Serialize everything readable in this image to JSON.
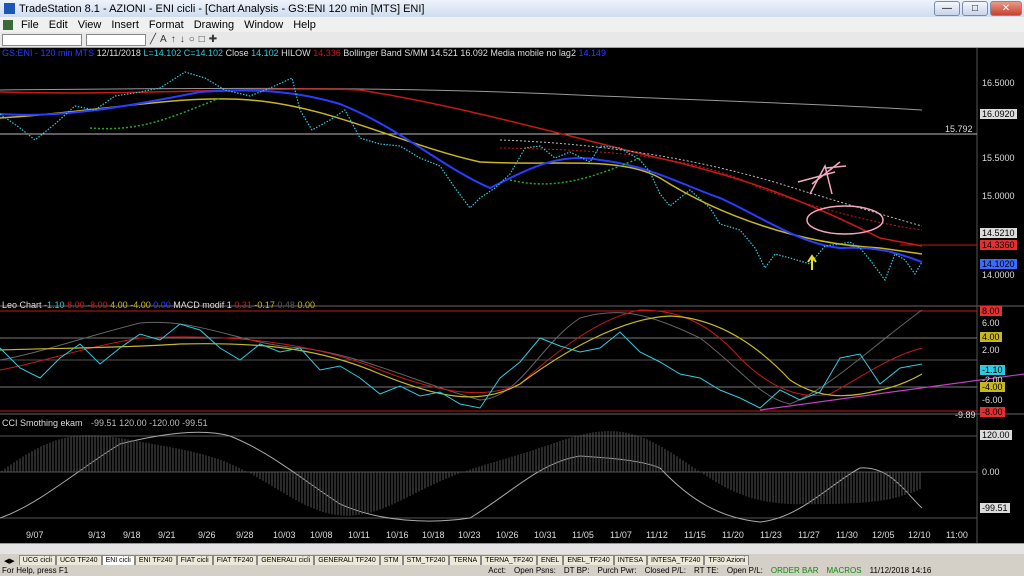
{
  "window": {
    "title": "TradeStation 8.1 - AZIONI - ENI cicli - [Chart Analysis - GS:ENI  120 min  [MTS] ENI]"
  },
  "menu": [
    "File",
    "Edit",
    "View",
    "Insert",
    "Format",
    "Drawing",
    "Window",
    "Help"
  ],
  "header": {
    "symbol": "GS:ENI - 120 min",
    "mts": "MTS",
    "date": "12/11/2018",
    "low": "L=14.102",
    "close": "C=14.102",
    "close_label": "Close",
    "close_val": "14.102",
    "hilow": "HILOW",
    "hilow_val": "14.336",
    "bb_label": "Bollinger Band S/MM",
    "bb_vals": "14.521  16.092",
    "ma_label": "Media mobile no lag2",
    "ma_val": "14.149"
  },
  "price_scale": [
    "16.5000",
    "16.0920",
    "15.792",
    "15.5000",
    "15.0000",
    "14.5210",
    "14.3360",
    "14.1020",
    "14.0000"
  ],
  "osc": {
    "title": "Leo Chart",
    "vals": [
      "-1.10",
      "8.00",
      "-8.00",
      "4.00",
      "-4.00",
      "0.00"
    ],
    "macd_label": "MACD modif 1",
    "macd_vals": [
      "0.31",
      "-0.17",
      "0.48",
      "0.00"
    ],
    "scale": [
      "8.00",
      "6.00",
      "4.00",
      "2.00",
      "-1.10",
      "-2.00",
      "-4.00",
      "-6.00",
      "-8.00",
      "-9.89"
    ]
  },
  "cci": {
    "title": "CCI Smothing ekam",
    "vals": "-99.51  120.00  -120.00  -99.51",
    "scale": [
      "120.00",
      "0.00",
      "-99.51"
    ]
  },
  "dates": [
    "9/07",
    "9/13",
    "9/18",
    "9/21",
    "9/26",
    "9/28",
    "10/03",
    "10/08",
    "10/11",
    "10/16",
    "10/18",
    "10/23",
    "10/26",
    "10/31",
    "11/05",
    "11/07",
    "11/12",
    "11/15",
    "11/20",
    "11/23",
    "11/27",
    "11/30",
    "12/05",
    "12/10",
    "11:00"
  ],
  "tabs": [
    "UCG cicli",
    "UCG TF240",
    "ENI cicli",
    "ENI TF240",
    "FIAT cicli",
    "FIAT TF240",
    "GENERALI cicli",
    "GENERALI TF240",
    "STM",
    "STM_TF240",
    "TERNA",
    "TERNA_TF240",
    "ENEL",
    "ENEL_TF240",
    "INTESA",
    "INTESA_TF240",
    "TF30 Azioni"
  ],
  "active_tab": "ENI cicli",
  "status": {
    "help": "For Help, press F1",
    "acct": "Acct:",
    "open_psns": "Open Psns:",
    "dt_bp": "DT BP:",
    "purch_pwr": "Purch Pwr:",
    "closed_pl": "Closed P/L:",
    "rt_te": "RT TE:",
    "open_pl": "Open P/L:",
    "order_bar": "ORDER BAR",
    "macros": "MACROS",
    "clock": "11/12/2018 14:16"
  },
  "colors": {
    "bg": "#000000",
    "price": "#2ecbe0",
    "blue": "#2a3cff",
    "red": "#c81818",
    "yellow": "#c8b820",
    "green": "#22aa22",
    "grey": "#888888"
  }
}
